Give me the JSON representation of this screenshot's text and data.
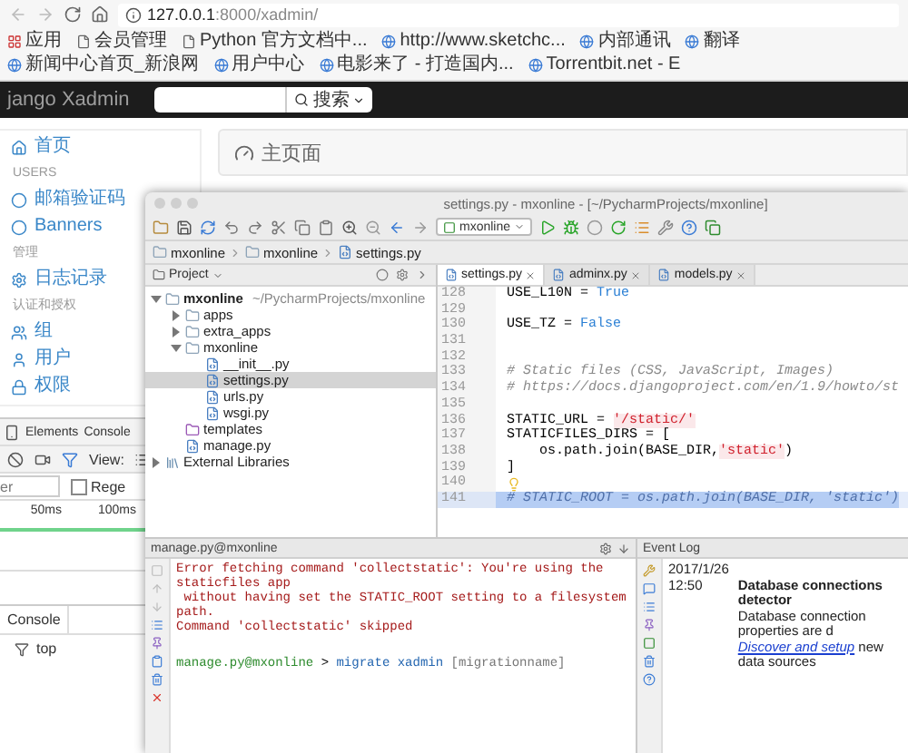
{
  "browser": {
    "url": {
      "host": "127.0.0.1",
      "path": ":8000/xadmin/"
    },
    "bookmarks": [
      {
        "label": "应用",
        "kind": "apps"
      },
      {
        "label": "会员管理",
        "kind": "page"
      },
      {
        "label": "Python 官方文档中...",
        "kind": "page"
      },
      {
        "label": "http://www.sketchc...",
        "kind": "site"
      },
      {
        "label": "内部通讯",
        "kind": "site"
      },
      {
        "label": "翻译",
        "kind": "site"
      },
      {
        "label": "新闻中心首页_新浪网",
        "kind": "site"
      },
      {
        "label": "用户中心",
        "kind": "site"
      },
      {
        "label": "电影来了 - 打造国内...",
        "kind": "site"
      },
      {
        "label": "Torrentbit.net - E",
        "kind": "site"
      }
    ]
  },
  "navbar": {
    "brand": "jango Xadmin",
    "search_button": "搜索"
  },
  "sidebar": {
    "items": [
      {
        "kind": "link",
        "label": "首页"
      },
      {
        "kind": "heading",
        "label": "USERS"
      },
      {
        "kind": "link",
        "label": "邮箱验证码"
      },
      {
        "kind": "link",
        "label": "Banners"
      },
      {
        "kind": "heading",
        "label": "管理"
      },
      {
        "kind": "link",
        "label": "日志记录"
      },
      {
        "kind": "heading",
        "label": "认证和授权"
      },
      {
        "kind": "link",
        "label": "组"
      },
      {
        "kind": "link",
        "label": "用户"
      },
      {
        "kind": "link",
        "label": "权限"
      }
    ]
  },
  "main": {
    "title": "主页面"
  },
  "devtools": {
    "tabs": [
      "Elements",
      "Console"
    ],
    "view_label": "View:",
    "filter_placeholder": "er",
    "regex_label": "Rege",
    "regex_checked": false,
    "timeline_ticks": [
      "50ms",
      "100ms"
    ],
    "drawer_tab": "Console",
    "context": "top"
  },
  "ide": {
    "title": "settings.py - mxonline - [~/PycharmProjects/mxonline]",
    "run_config": "mxonline",
    "breadcrumbs": [
      "mxonline",
      "mxonline",
      "settings.py"
    ],
    "project_label": "Project",
    "tree": [
      {
        "label": "mxonline",
        "note": "~/PycharmProjects/mxonline",
        "kind": "folder",
        "expanded": true,
        "selected": false,
        "children": [
          {
            "label": "apps",
            "kind": "folder",
            "expanded": false,
            "selected": false
          },
          {
            "label": "extra_apps",
            "kind": "folder",
            "expanded": false,
            "selected": false
          },
          {
            "label": "mxonline",
            "kind": "folder",
            "expanded": true,
            "selected": false,
            "children": [
              {
                "label": "__init__.py",
                "kind": "file",
                "selected": false
              },
              {
                "label": "settings.py",
                "kind": "file",
                "selected": true
              },
              {
                "label": "urls.py",
                "kind": "file",
                "selected": false
              },
              {
                "label": "wsgi.py",
                "kind": "file",
                "selected": false
              }
            ]
          },
          {
            "label": "templates",
            "kind": "templates",
            "selected": false
          },
          {
            "label": "manage.py",
            "kind": "file",
            "selected": false
          }
        ]
      },
      {
        "label": "External Libraries",
        "kind": "library",
        "expanded": false,
        "selected": false
      }
    ],
    "tabs": [
      {
        "label": "settings.py",
        "selected": true
      },
      {
        "label": "adminx.py",
        "selected": false
      },
      {
        "label": "models.py",
        "selected": false
      }
    ],
    "code": [
      {
        "number": "128",
        "selected": false,
        "bulb": false,
        "tokens": [
          {
            "kind": "plain",
            "text": "USE_L10N = "
          },
          {
            "kind": "const",
            "text": "True"
          }
        ]
      },
      {
        "number": "129",
        "selected": false,
        "bulb": false
      },
      {
        "number": "130",
        "selected": false,
        "bulb": false,
        "tokens": [
          {
            "kind": "plain",
            "text": "USE_TZ = "
          },
          {
            "kind": "const",
            "text": "False"
          }
        ]
      },
      {
        "number": "131",
        "selected": false,
        "bulb": false
      },
      {
        "number": "132",
        "selected": false,
        "bulb": false
      },
      {
        "number": "133",
        "selected": false,
        "bulb": false,
        "tokens": [
          {
            "kind": "comment",
            "text": "# Static files (CSS, JavaScript, Images)"
          }
        ]
      },
      {
        "number": "134",
        "selected": false,
        "bulb": false,
        "tokens": [
          {
            "kind": "comment",
            "text": "# https://docs.djangoproject.com/en/1.9/howto/st"
          }
        ]
      },
      {
        "number": "135",
        "selected": false,
        "bulb": false
      },
      {
        "number": "136",
        "selected": false,
        "bulb": false,
        "tokens": [
          {
            "kind": "plain",
            "text": "STATIC_URL = "
          },
          {
            "kind": "string",
            "text": "'/static/'"
          }
        ]
      },
      {
        "number": "137",
        "selected": false,
        "bulb": false,
        "tokens": [
          {
            "kind": "plain",
            "text": "STATICFILES_DIRS = ["
          }
        ]
      },
      {
        "number": "138",
        "selected": false,
        "bulb": false,
        "tokens": [
          {
            "kind": "plain",
            "text": "    os.path.join(BASE_DIR,"
          },
          {
            "kind": "string",
            "text": "'static'"
          },
          {
            "kind": "plain",
            "text": ")"
          }
        ]
      },
      {
        "number": "139",
        "selected": false,
        "bulb": false,
        "tokens": [
          {
            "kind": "plain",
            "text": "]"
          }
        ]
      },
      {
        "number": "140",
        "selected": false,
        "bulb": true
      },
      {
        "number": "141",
        "selected": true,
        "bulb": false,
        "tokens": [
          {
            "kind": "comment",
            "text": "# STATIC_ROOT = os.path.join(BASE_DIR, 'static')"
          }
        ]
      }
    ],
    "console": {
      "title": "manage.py@mxonline",
      "lines": [
        {
          "tokens": [
            {
              "kind": "error",
              "text": "Error fetching command 'collectstatic': You're using the staticfiles app"
            }
          ]
        },
        {
          "tokens": [
            {
              "kind": "error",
              "text": " without having set the STATIC_ROOT setting to a filesystem path."
            }
          ]
        },
        {
          "tokens": [
            {
              "kind": "error",
              "text": "Command 'collectstatic' skipped"
            }
          ]
        },
        {
          "tokens": [
            {
              "kind": "prompt",
              "text": "manage.py@mxonline"
            },
            {
              "kind": "plain",
              "text": " > "
            },
            {
              "kind": "command",
              "text": "migrate xadmin"
            },
            {
              "kind": "hint",
              "text": " [migrationname]"
            }
          ]
        }
      ]
    },
    "event_log": {
      "title": "Event Log",
      "date": "2017/1/26",
      "time": "12:50",
      "heading": "Database connections detector",
      "body": "Database connection properties are d",
      "link": "Discover and setup",
      "link_rest": " new data sources"
    }
  }
}
